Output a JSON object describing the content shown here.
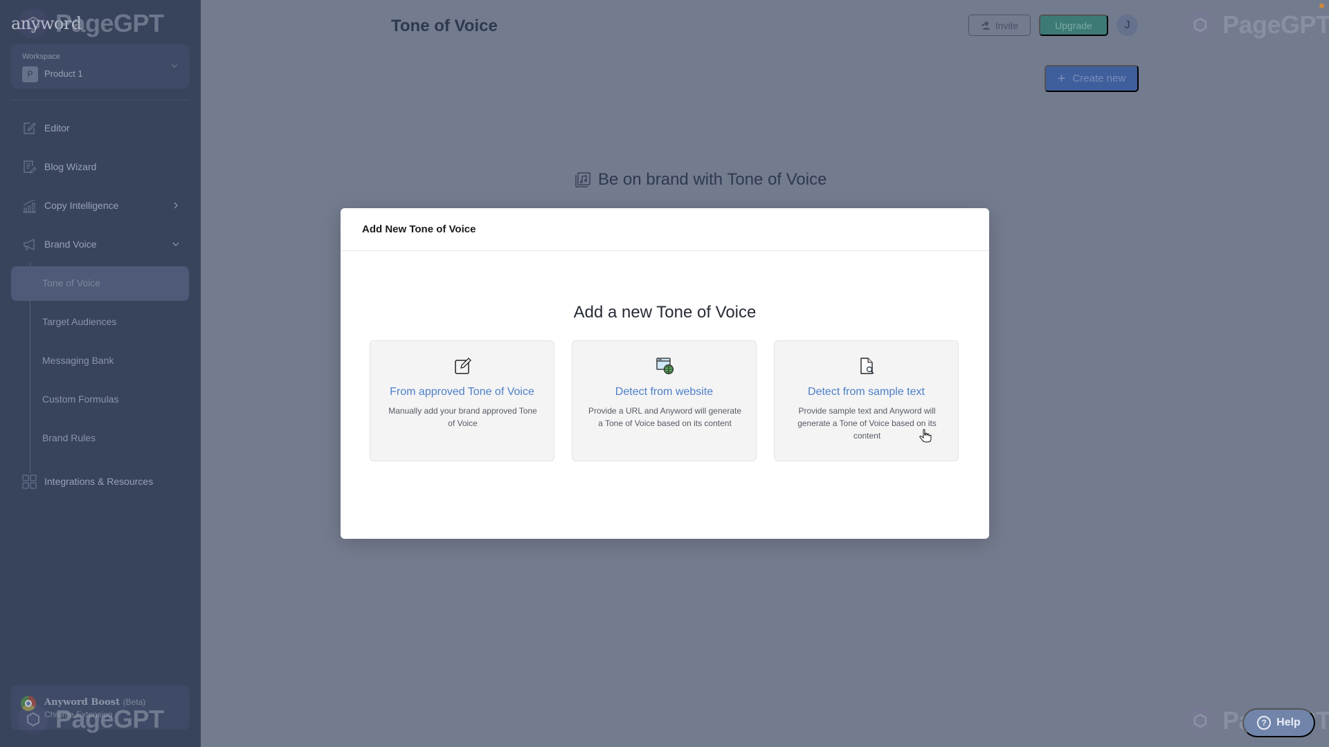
{
  "app": {
    "logo": "anyword",
    "watermark": "PageGPT"
  },
  "sidebar": {
    "workspace": {
      "label": "Workspace",
      "badge": "P",
      "name": "Product 1"
    },
    "items": [
      {
        "label": "Editor",
        "icon": "edit-icon"
      },
      {
        "label": "Blog Wizard",
        "icon": "blog-icon"
      },
      {
        "label": "Copy Intelligence",
        "icon": "chart-icon",
        "expandable": true
      },
      {
        "label": "Brand Voice",
        "icon": "megaphone-icon",
        "expanded": true
      },
      {
        "label": "Integrations & Resources",
        "icon": "grid-icon"
      }
    ],
    "brand_voice_subitems": [
      {
        "label": "Tone of Voice",
        "active": true
      },
      {
        "label": "Target Audiences"
      },
      {
        "label": "Messaging Bank"
      },
      {
        "label": "Custom Formulas"
      },
      {
        "label": "Brand Rules"
      }
    ],
    "boost": {
      "title": "Anyword Boost",
      "badge": "(Beta)",
      "subtitle": "Chrome Extension"
    }
  },
  "header": {
    "title": "Tone of Voice",
    "invite_label": "Invite",
    "upgrade_label": "Upgrade",
    "avatar_initial": "J",
    "create_label": "Create new"
  },
  "main": {
    "hero_text": "Be on brand with Tone of Voice"
  },
  "modal": {
    "title": "Add New Tone of Voice",
    "heading": "Add a new Tone of Voice",
    "cards": [
      {
        "icon": "edit-note-icon",
        "title": "From approved Tone of Voice",
        "description": "Manually add your brand approved Tone of Voice"
      },
      {
        "icon": "website-globe-icon",
        "title": "Detect from website",
        "description": "Provide a URL and Anyword will generate a Tone of Voice based on its content"
      },
      {
        "icon": "document-search-icon",
        "title": "Detect from sample text",
        "description": "Provide sample text and Anyword will generate a Tone of Voice based on its content"
      }
    ]
  },
  "help": {
    "label": "Help"
  },
  "colors": {
    "sidebar_bg": "#38435c",
    "overlay_bg": "#737b8e",
    "upgrade": "#3d7a76",
    "create": "#3f5e9c",
    "card_title": "#4c7fc6",
    "help": "#7185ab"
  }
}
